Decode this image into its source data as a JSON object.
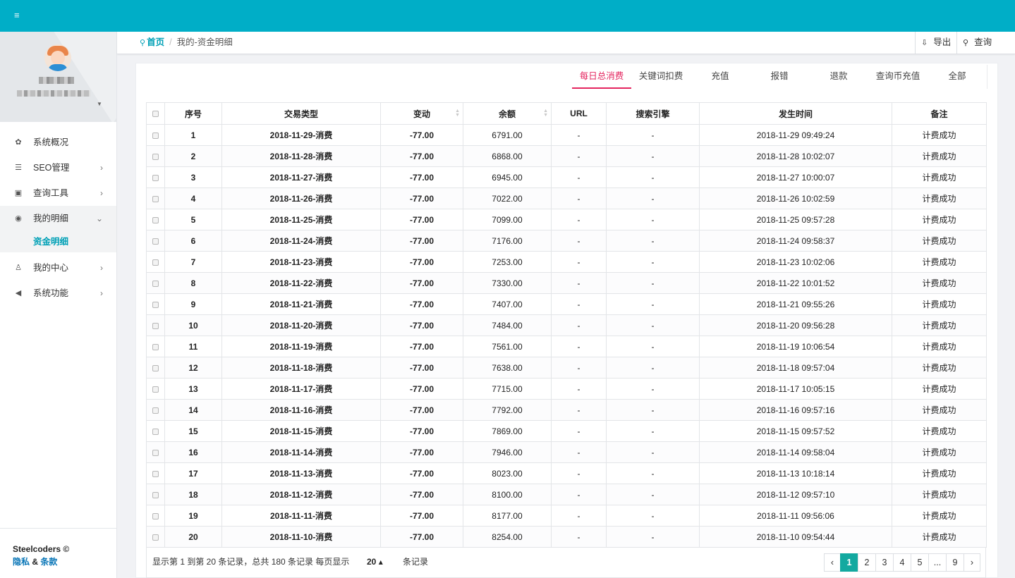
{
  "topbar": {
    "menu_icon": "hamburger-icon"
  },
  "sidebar": {
    "items": [
      {
        "label": "系统概况",
        "icon": "dashboard-icon",
        "chevron": ""
      },
      {
        "label": "SEO管理",
        "icon": "list-icon",
        "chevron": "›"
      },
      {
        "label": "查询工具",
        "icon": "search-box-icon",
        "chevron": "›"
      },
      {
        "label": "我的明细",
        "icon": "user-circle-icon",
        "chevron": "⌄"
      },
      {
        "label": "资金明细"
      },
      {
        "label": "我的中心",
        "icon": "person-icon",
        "chevron": "›"
      },
      {
        "label": "系统功能",
        "icon": "speaker-icon",
        "chevron": "›"
      }
    ],
    "footer": {
      "brand": "Steelcoders ©",
      "privacy": "隐私",
      "amp": "&",
      "terms": "条款"
    }
  },
  "breadcrumb": {
    "home": "首页",
    "sep": "/",
    "current": "我的-资金明细"
  },
  "toolbar": {
    "export_label": "导出",
    "query_label": "查询"
  },
  "tabs": [
    "每日总消费",
    "关键词扣费",
    "充值",
    "报错",
    "退款",
    "查询币充值",
    "全部"
  ],
  "table": {
    "columns": [
      "序号",
      "交易类型",
      "变动",
      "余额",
      "URL",
      "搜索引擎",
      "发生时间",
      "备注"
    ],
    "rows": [
      [
        "1",
        "2018-11-29-消费",
        "-77.00",
        "6791.00",
        "-",
        "-",
        "2018-11-29 09:49:24",
        "计费成功"
      ],
      [
        "2",
        "2018-11-28-消费",
        "-77.00",
        "6868.00",
        "-",
        "-",
        "2018-11-28 10:02:07",
        "计费成功"
      ],
      [
        "3",
        "2018-11-27-消费",
        "-77.00",
        "6945.00",
        "-",
        "-",
        "2018-11-27 10:00:07",
        "计费成功"
      ],
      [
        "4",
        "2018-11-26-消费",
        "-77.00",
        "7022.00",
        "-",
        "-",
        "2018-11-26 10:02:59",
        "计费成功"
      ],
      [
        "5",
        "2018-11-25-消费",
        "-77.00",
        "7099.00",
        "-",
        "-",
        "2018-11-25 09:57:28",
        "计费成功"
      ],
      [
        "6",
        "2018-11-24-消费",
        "-77.00",
        "7176.00",
        "-",
        "-",
        "2018-11-24 09:58:37",
        "计费成功"
      ],
      [
        "7",
        "2018-11-23-消费",
        "-77.00",
        "7253.00",
        "-",
        "-",
        "2018-11-23 10:02:06",
        "计费成功"
      ],
      [
        "8",
        "2018-11-22-消费",
        "-77.00",
        "7330.00",
        "-",
        "-",
        "2018-11-22 10:01:52",
        "计费成功"
      ],
      [
        "9",
        "2018-11-21-消费",
        "-77.00",
        "7407.00",
        "-",
        "-",
        "2018-11-21 09:55:26",
        "计费成功"
      ],
      [
        "10",
        "2018-11-20-消费",
        "-77.00",
        "7484.00",
        "-",
        "-",
        "2018-11-20 09:56:28",
        "计费成功"
      ],
      [
        "11",
        "2018-11-19-消费",
        "-77.00",
        "7561.00",
        "-",
        "-",
        "2018-11-19 10:06:54",
        "计费成功"
      ],
      [
        "12",
        "2018-11-18-消费",
        "-77.00",
        "7638.00",
        "-",
        "-",
        "2018-11-18 09:57:04",
        "计费成功"
      ],
      [
        "13",
        "2018-11-17-消费",
        "-77.00",
        "7715.00",
        "-",
        "-",
        "2018-11-17 10:05:15",
        "计费成功"
      ],
      [
        "14",
        "2018-11-16-消费",
        "-77.00",
        "7792.00",
        "-",
        "-",
        "2018-11-16 09:57:16",
        "计费成功"
      ],
      [
        "15",
        "2018-11-15-消费",
        "-77.00",
        "7869.00",
        "-",
        "-",
        "2018-11-15 09:57:52",
        "计费成功"
      ],
      [
        "16",
        "2018-11-14-消费",
        "-77.00",
        "7946.00",
        "-",
        "-",
        "2018-11-14 09:58:04",
        "计费成功"
      ],
      [
        "17",
        "2018-11-13-消费",
        "-77.00",
        "8023.00",
        "-",
        "-",
        "2018-11-13 10:18:14",
        "计费成功"
      ],
      [
        "18",
        "2018-11-12-消费",
        "-77.00",
        "8100.00",
        "-",
        "-",
        "2018-11-12 09:57:10",
        "计费成功"
      ],
      [
        "19",
        "2018-11-11-消费",
        "-77.00",
        "8177.00",
        "-",
        "-",
        "2018-11-11 09:56:06",
        "计费成功"
      ],
      [
        "20",
        "2018-11-10-消费",
        "-77.00",
        "8254.00",
        "-",
        "-",
        "2018-11-10 09:54:44",
        "计费成功"
      ]
    ]
  },
  "pagination": {
    "info": "显示第 1 到第 20 条记录，总共 180 条记录 每页显示",
    "page_size": "20",
    "page_size_caret": "▴",
    "unit": "条记录",
    "prev": "‹",
    "pages": [
      "1",
      "2",
      "3",
      "4",
      "5",
      "...",
      "9"
    ],
    "next": "›",
    "current_page": "1"
  },
  "colors": {
    "topbar": "#00aec7",
    "accent": "#00a0b6",
    "active_tab": "#e4255f",
    "active_page": "#13a9a0"
  }
}
